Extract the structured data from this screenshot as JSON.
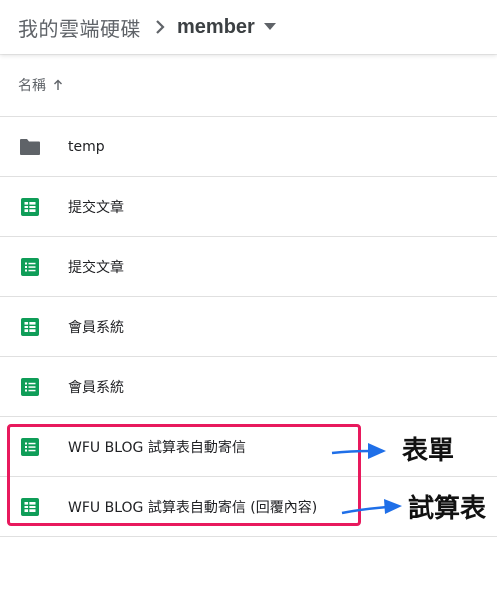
{
  "breadcrumb": {
    "root": "我的雲端硬碟",
    "current": "member"
  },
  "column_header": {
    "name_label": "名稱"
  },
  "files": [
    {
      "name": "temp",
      "icon": "folder-icon",
      "type": "folder"
    },
    {
      "name": "提交文章",
      "icon": "sheets-icon",
      "type": "spreadsheet"
    },
    {
      "name": "提交文章",
      "icon": "forms-icon",
      "type": "form"
    },
    {
      "name": "會員系統",
      "icon": "sheets-icon",
      "type": "spreadsheet"
    },
    {
      "name": "會員系統",
      "icon": "forms-icon",
      "type": "form"
    },
    {
      "name": "WFU BLOG 試算表自動寄信",
      "icon": "forms-icon",
      "type": "form"
    },
    {
      "name": "WFU BLOG 試算表自動寄信 (回覆內容)",
      "icon": "sheets-icon",
      "type": "spreadsheet"
    }
  ],
  "annotations": {
    "form_label": "表單",
    "sheet_label": "試算表"
  },
  "colors": {
    "sheets_green": "#0f9d58",
    "folder_gray": "#5f6368",
    "highlight_pink": "#e8195d",
    "arrow_blue": "#1f6fe8"
  }
}
